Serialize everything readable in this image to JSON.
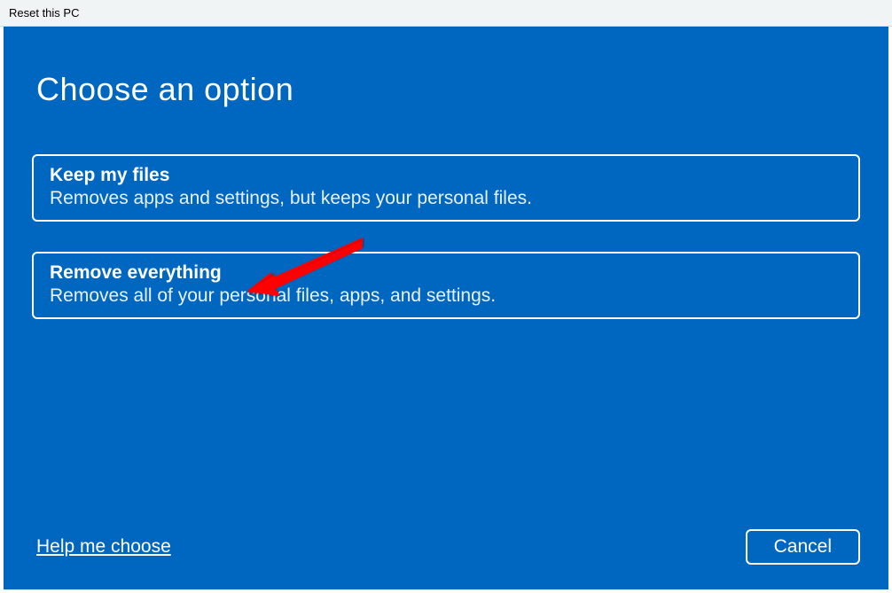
{
  "window": {
    "title": "Reset this PC"
  },
  "heading": "Choose an option",
  "options": [
    {
      "title": "Keep my files",
      "description": "Removes apps and settings, but keeps your personal files."
    },
    {
      "title": "Remove everything",
      "description": "Removes all of your personal files, apps, and settings."
    }
  ],
  "footer": {
    "help_link": "Help me choose",
    "cancel_label": "Cancel"
  },
  "colors": {
    "panel_bg": "#0067c0",
    "titlebar_bg": "#f0f4f5",
    "annotation_arrow": "#ff0000"
  }
}
